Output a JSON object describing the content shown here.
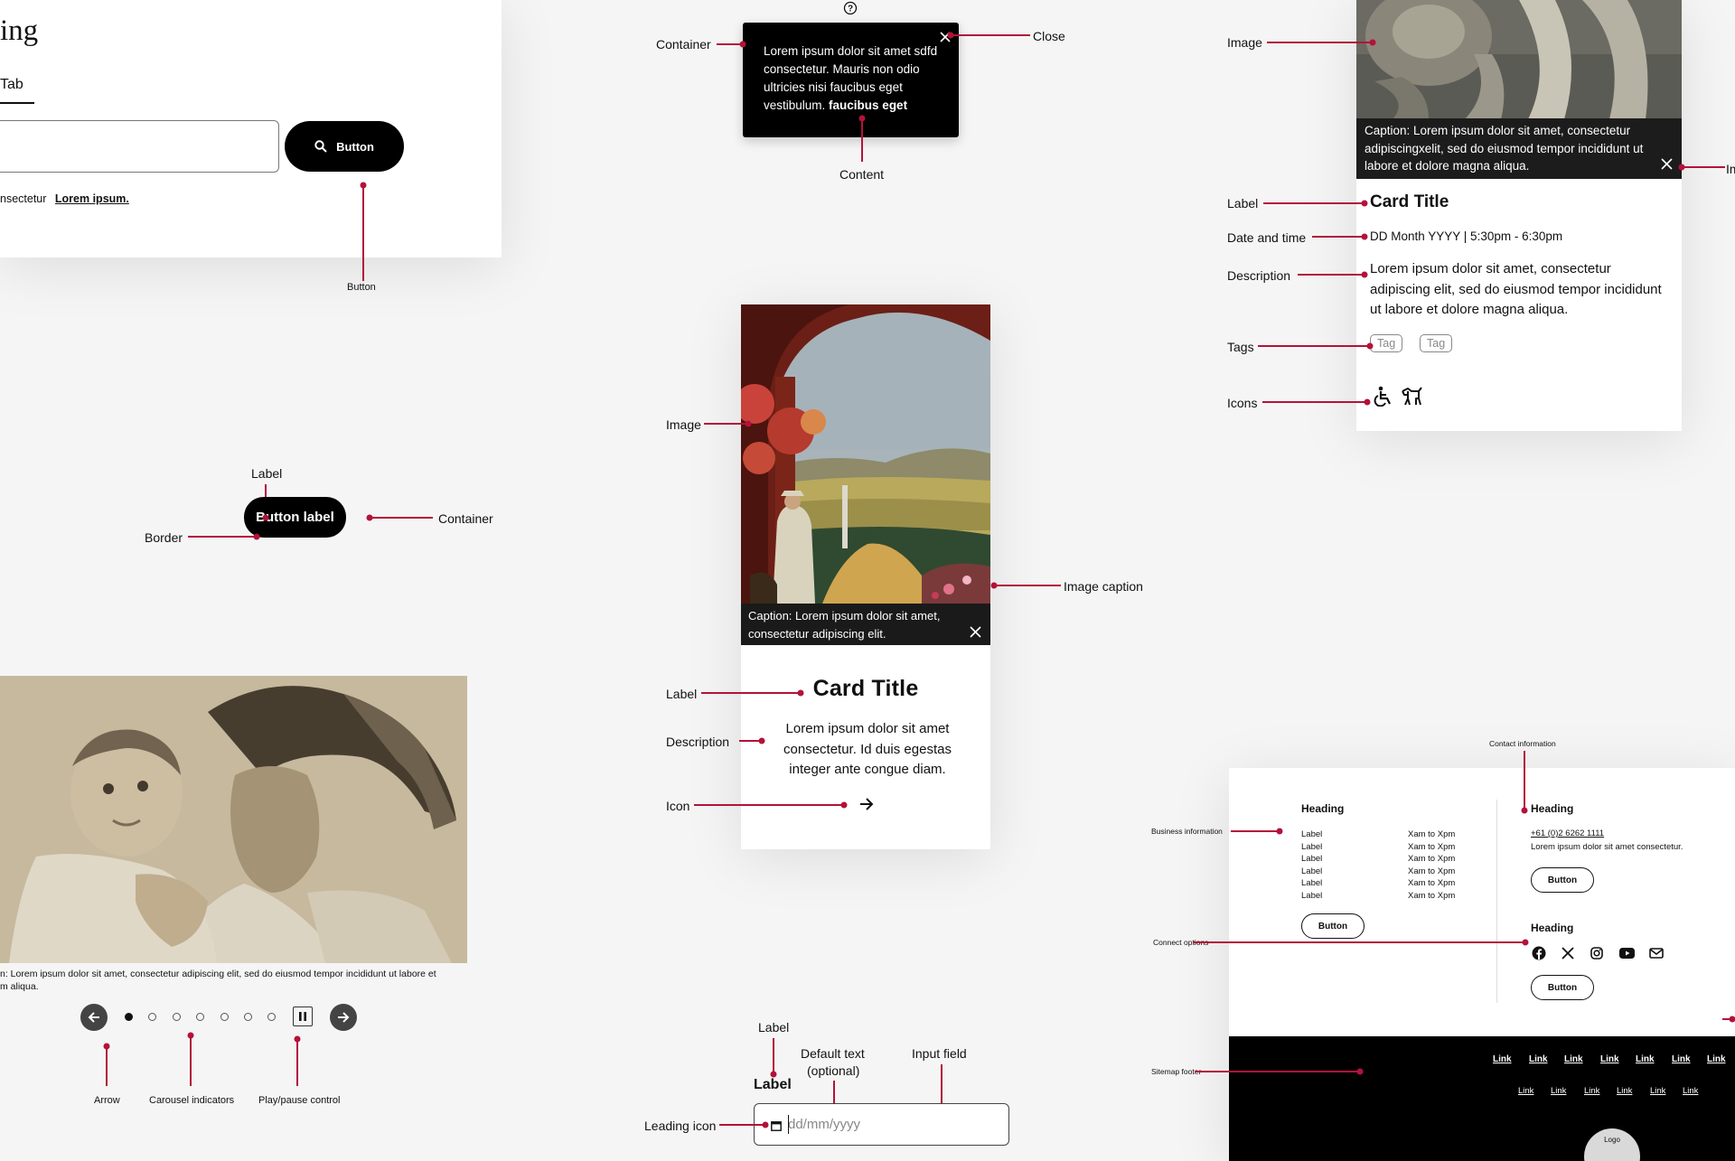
{
  "colors": {
    "accent": "#b3123a",
    "dark": "#000000",
    "bg": "#f5f5f5"
  },
  "search_panel": {
    "heading": "ing",
    "tab": "Tab",
    "button": "Button",
    "helper_text": "nsectetur",
    "helper_link": "Lorem ipsum.",
    "annotations": {
      "button": "Button"
    }
  },
  "tooltip": {
    "text": "Lorem ipsum dolor sit amet sdfd consectetur. Mauris non odio ultricies nisi faucibus eget vestibulum.",
    "bold": "faucibus eget",
    "icons": [
      "help-icon",
      "close-icon"
    ],
    "annotations": {
      "container": "Container",
      "close": "Close",
      "content": "Content"
    }
  },
  "event_card": {
    "caption": "Caption: Lorem ipsum dolor sit amet, consectetur adipiscingxelit, sed do eiusmod tempor incididunt ut labore et dolore magna aliqua.",
    "title": "Card Title",
    "datetime": "DD Month YYYY | 5:30pm - 6:30pm",
    "description": "Lorem ipsum dolor sit amet, consectetur adipiscing elit, sed do eiusmod tempor incididunt ut labore et dolore magna aliqua.",
    "tags": [
      "Tag",
      "Tag"
    ],
    "icons": [
      "wheelchair-icon",
      "assistance-dog-icon"
    ],
    "annotations": {
      "image": "Image",
      "label": "Label",
      "datetime": "Date and time",
      "description": "Description",
      "tags": "Tags",
      "icons": "Icons",
      "edge": "Im"
    }
  },
  "pill": {
    "label": "Button label",
    "annotations": {
      "label": "Label",
      "border": "Border",
      "container": "Container"
    }
  },
  "image_card": {
    "caption": "Caption: Lorem ipsum dolor sit amet, consectetur adipiscing elit.",
    "title": "Card Title",
    "description": "Lorem ipsum dolor sit amet consectetur. Id duis egestas integer ante congue diam.",
    "icons": [
      "close-icon",
      "arrow-right-icon"
    ],
    "annotations": {
      "image": "Image",
      "caption": "Image caption",
      "label": "Label",
      "description": "Description",
      "icon": "Icon"
    }
  },
  "carousel": {
    "caption": "n: Lorem ipsum dolor sit amet, consectetur adipiscing elit, sed do eiusmod tempor incididunt ut labore et m aliqua.",
    "active_index": 0,
    "indicator_count": 7,
    "icons": [
      "arrow-left-icon",
      "arrow-right-icon",
      "pause-icon"
    ],
    "annotations": {
      "arrow": "Arrow",
      "indicators": "Carousel indicators",
      "play": "Play/pause control"
    }
  },
  "date_input": {
    "label": "Label",
    "placeholder": "dd/mm/yyyy",
    "icon": "calendar-icon",
    "annotations": {
      "label": "Label",
      "default": "Default text",
      "optional": "(optional)",
      "field": "Input field",
      "leading": "Leading icon"
    }
  },
  "footer": {
    "business": {
      "heading": "Heading",
      "rows": [
        [
          "Label",
          "Xam to Xpm"
        ],
        [
          "Label",
          "Xam to Xpm"
        ],
        [
          "Label",
          "Xam to Xpm"
        ],
        [
          "Label",
          "Xam to Xpm"
        ],
        [
          "Label",
          "Xam to Xpm"
        ],
        [
          "Label",
          "Xam to Xpm"
        ]
      ],
      "button": "Button"
    },
    "contact": {
      "heading": "Heading",
      "phone": "+61 (0)2 6262 1111",
      "text": "Lorem ipsum dolor sit amet consectetur.",
      "button": "Button"
    },
    "connect": {
      "heading": "Heading",
      "icons": [
        "facebook-icon",
        "x-icon",
        "instagram-icon",
        "youtube-icon",
        "mail-icon"
      ],
      "button": "Button"
    },
    "sitemap_links_row1": [
      "Link",
      "Link",
      "Link",
      "Link",
      "Link",
      "Link",
      "Link"
    ],
    "sitemap_links_row2": [
      "Link",
      "Link",
      "Link",
      "Link",
      "Link",
      "Link"
    ],
    "logo": "Logo",
    "annotations": {
      "contact": "Contact information",
      "business": "Business information",
      "connect": "Connect options",
      "sitemap": "Sitemap footer"
    }
  }
}
